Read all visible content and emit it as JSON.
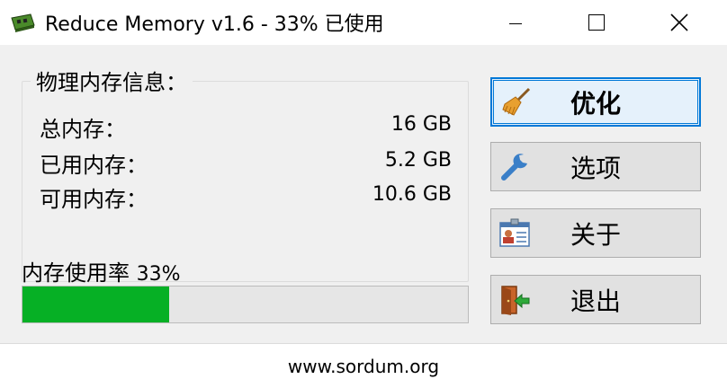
{
  "window": {
    "title": "Reduce Memory v1.6 - 33% 已使用",
    "icon": "memory-chip-icon"
  },
  "memory_info": {
    "group_title": "物理内存信息：",
    "rows": [
      {
        "label": "总内存：",
        "value": "16 GB"
      },
      {
        "label": "已用内存：",
        "value": "5.2 GB"
      },
      {
        "label": "可用内存：",
        "value": "10.6 GB"
      }
    ]
  },
  "usage": {
    "label": "内存使用率",
    "percent_text": "33%",
    "fraction": 0.33,
    "bar_color": "#06b025"
  },
  "buttons": [
    {
      "label": "优化",
      "icon": "broom-icon",
      "default": true
    },
    {
      "label": "选项",
      "icon": "wrench-icon",
      "default": false
    },
    {
      "label": "关于",
      "icon": "id-card-icon",
      "default": false
    },
    {
      "label": "退出",
      "icon": "exit-door-icon",
      "default": false
    }
  ],
  "footer": {
    "link": "www.sordum.org"
  },
  "colors": {
    "accent": "#0078d7",
    "dialog_bg": "#f0f0f0"
  }
}
